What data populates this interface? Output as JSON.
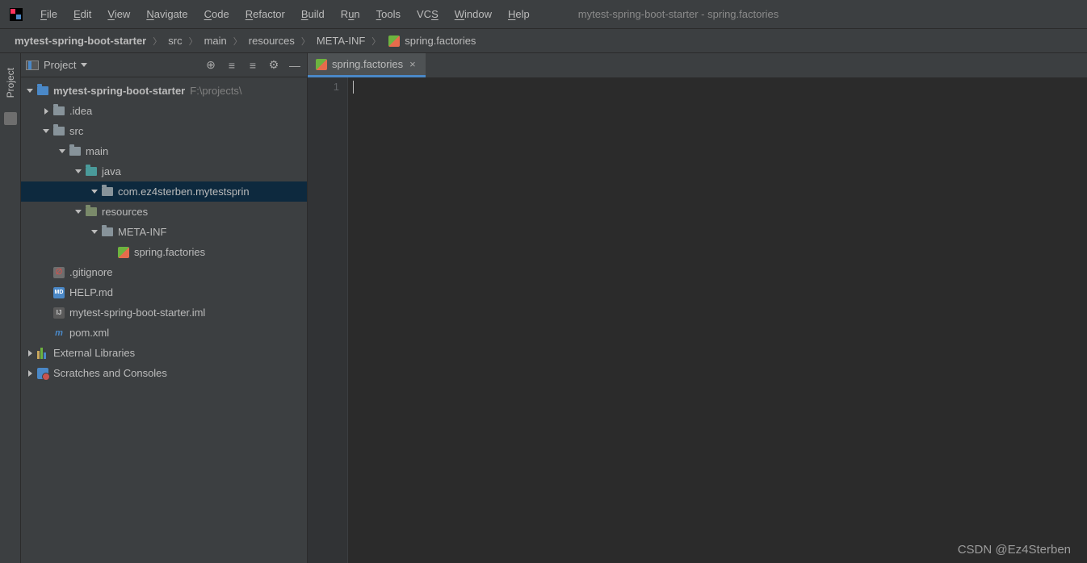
{
  "menubar": {
    "items": [
      {
        "label": "File",
        "u": "F"
      },
      {
        "label": "Edit",
        "u": "E"
      },
      {
        "label": "View",
        "u": "V"
      },
      {
        "label": "Navigate",
        "u": "N"
      },
      {
        "label": "Code",
        "u": "C"
      },
      {
        "label": "Refactor",
        "u": "R"
      },
      {
        "label": "Build",
        "u": "B"
      },
      {
        "label": "Run",
        "u": "u"
      },
      {
        "label": "Tools",
        "u": "T"
      },
      {
        "label": "VCS",
        "u": "S"
      },
      {
        "label": "Window",
        "u": "W"
      },
      {
        "label": "Help",
        "u": "H"
      }
    ],
    "window_title": "mytest-spring-boot-starter - spring.factories"
  },
  "breadcrumb": {
    "items": [
      {
        "label": "mytest-spring-boot-starter",
        "bold": true
      },
      {
        "label": "src"
      },
      {
        "label": "main"
      },
      {
        "label": "resources"
      },
      {
        "label": "META-INF"
      },
      {
        "label": "spring.factories",
        "icon": "spring"
      }
    ]
  },
  "sidebar_gutter": {
    "project_label": "Project"
  },
  "project_panel": {
    "title": "Project",
    "tree": {
      "root_label": "mytest-spring-boot-starter",
      "root_path": "F:\\projects\\",
      "idea_label": ".idea",
      "src_label": "src",
      "main_label": "main",
      "java_label": "java",
      "pkg_label": "com.ez4sterben.mytestsprin",
      "resources_label": "resources",
      "metainf_label": "META-INF",
      "factories_label": "spring.factories",
      "gitignore_label": ".gitignore",
      "help_label": "HELP.md",
      "iml_label": "mytest-spring-boot-starter.iml",
      "pom_label": "pom.xml",
      "external_label": "External Libraries",
      "scratches_label": "Scratches and Consoles"
    }
  },
  "editor": {
    "tab_label": "spring.factories",
    "line_number": "1"
  },
  "watermark": "CSDN @Ez4Sterben"
}
